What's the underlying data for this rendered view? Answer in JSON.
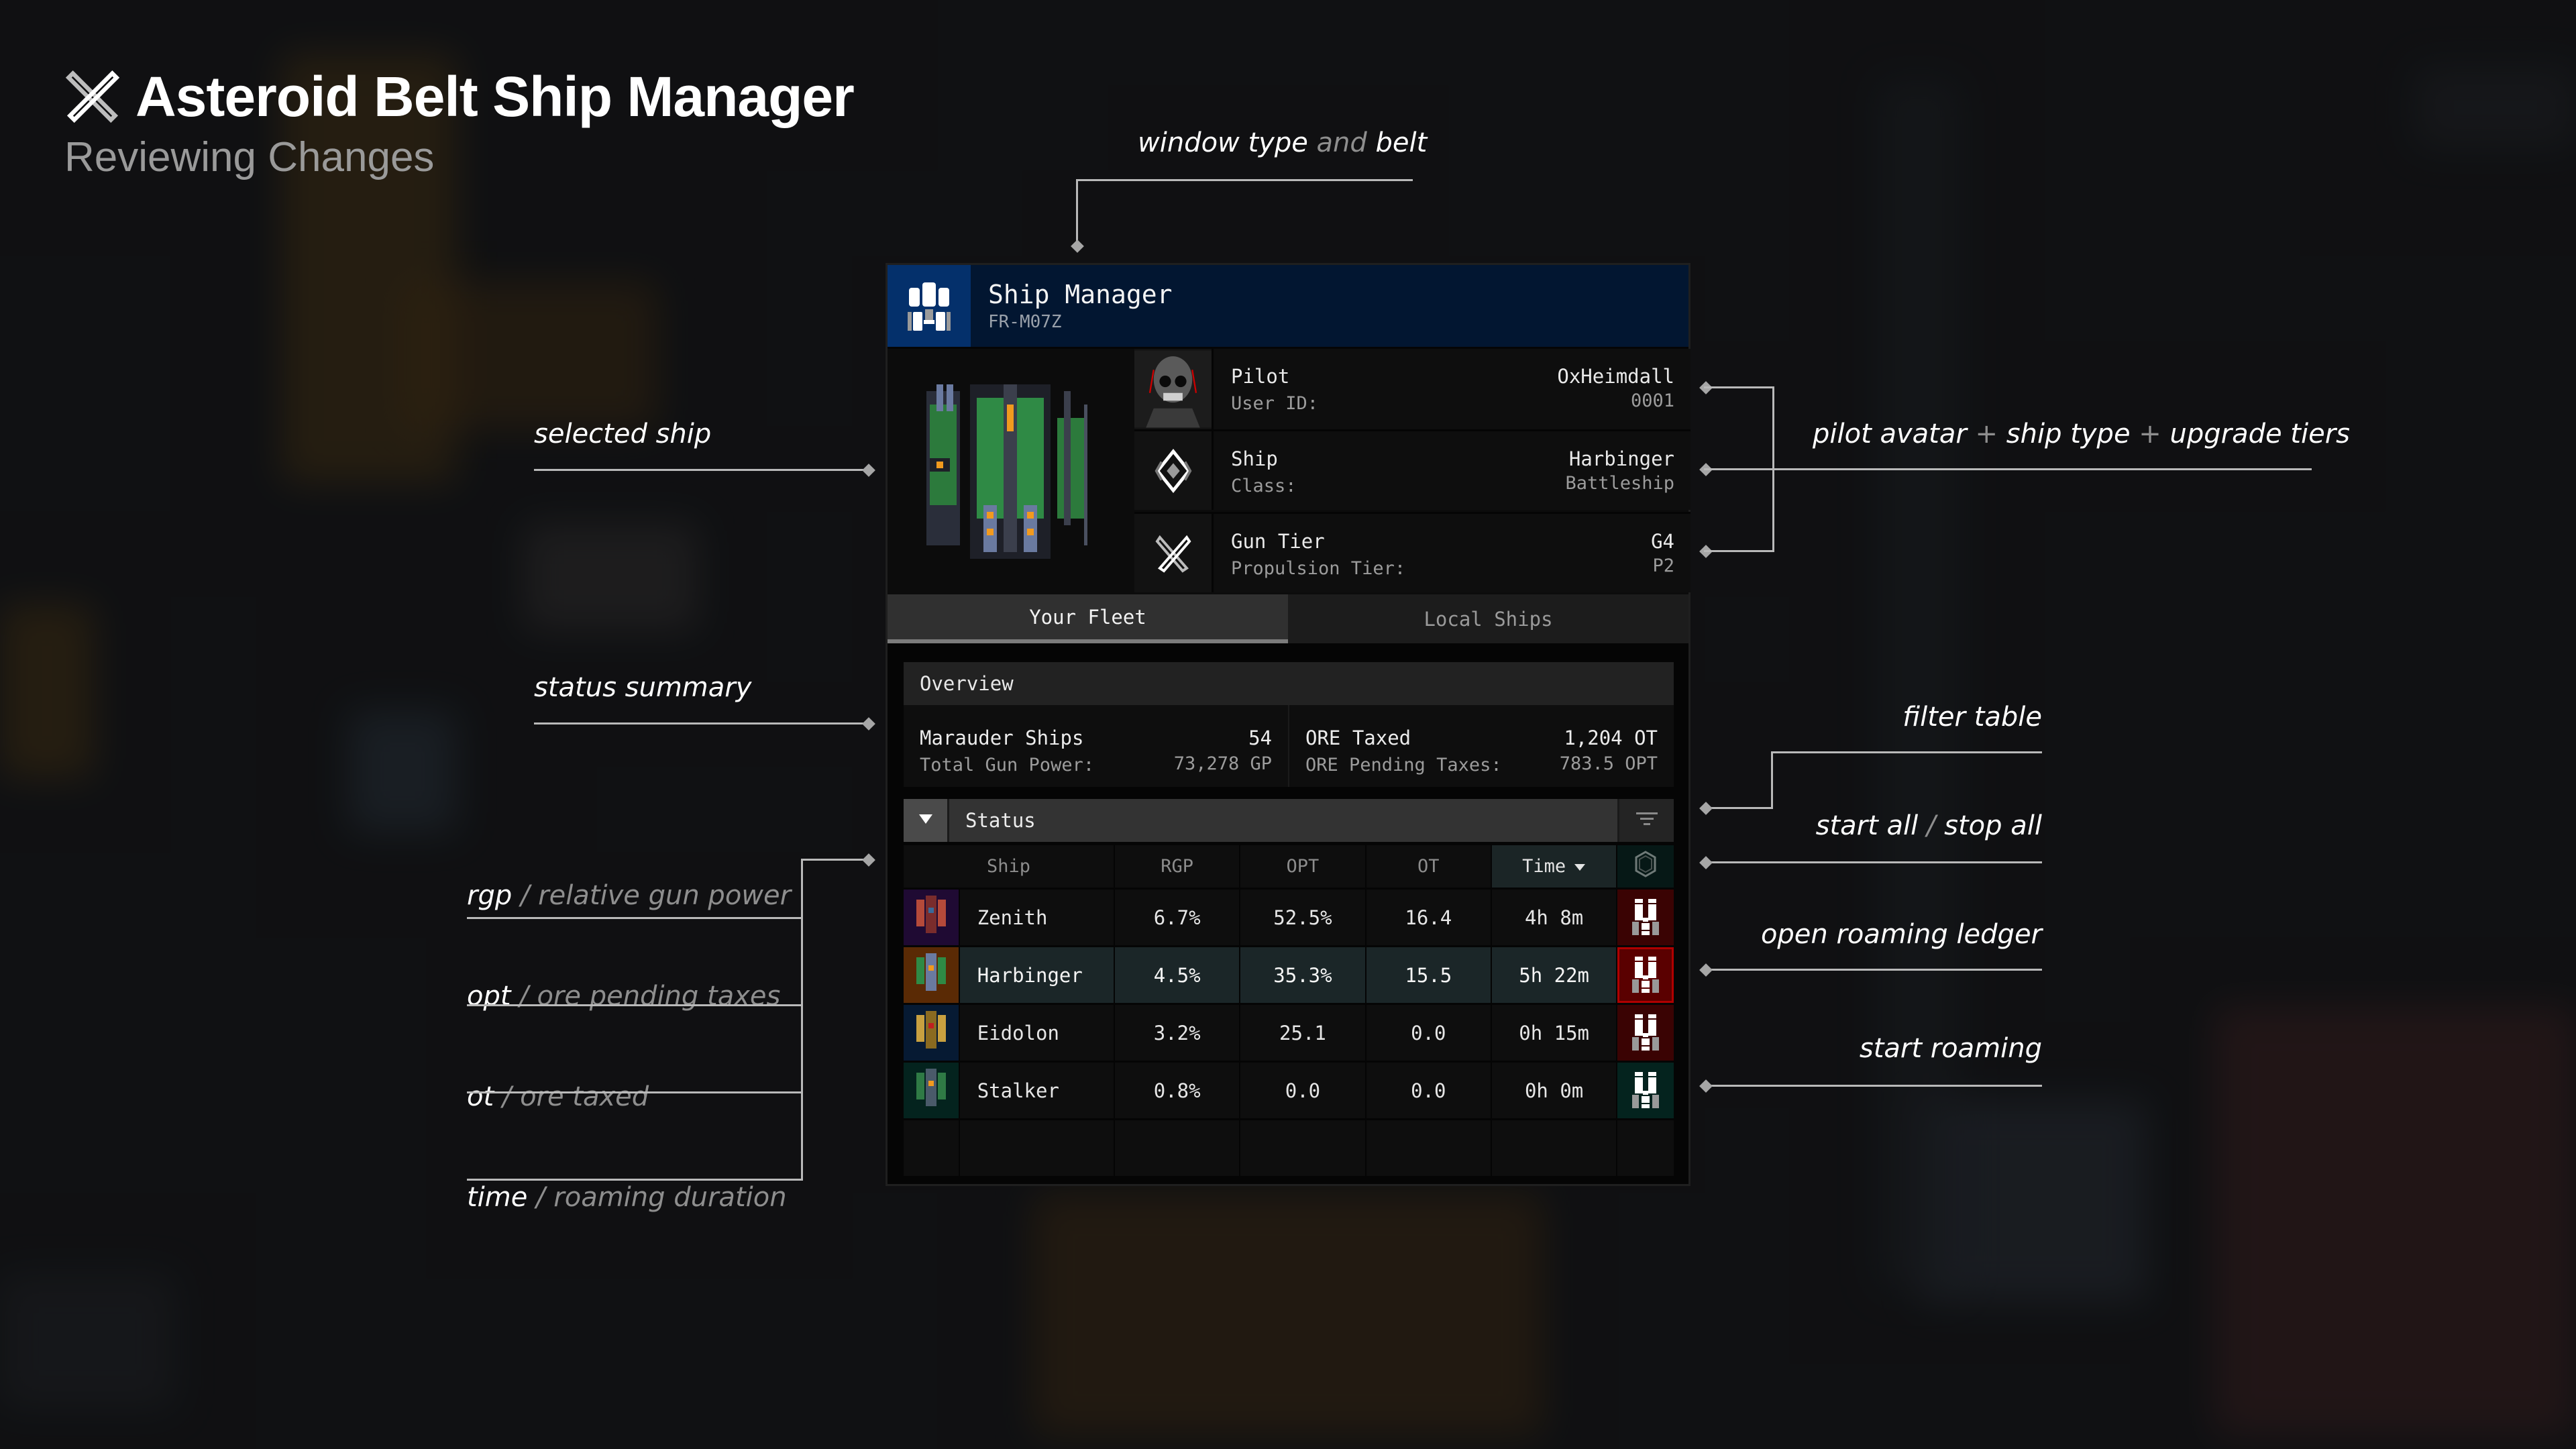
{
  "heading": {
    "title": "Asteroid Belt Ship Manager",
    "subtitle": "Reviewing Changes",
    "icon": "tools-icon"
  },
  "annotations": {
    "window_type": {
      "a": "window type",
      "b": " and ",
      "c": "belt"
    },
    "selected_ship": "selected ship",
    "status_summary": "status summary",
    "pilot_info": {
      "a": "pilot avatar",
      "sep1": " + ",
      "b": "ship type",
      "sep2": " + ",
      "c": "upgrade tiers"
    },
    "filter_table": "filter table",
    "start_stop": {
      "a": "start all",
      "sep": " / ",
      "b": "stop all"
    },
    "open_ledger": "open roaming ledger",
    "start_roaming": "start roaming",
    "rgp": {
      "key": "rgp",
      "sep": " / ",
      "desc": "relative gun power"
    },
    "opt": {
      "key": "opt",
      "sep": " / ",
      "desc": "ore pending taxes"
    },
    "ot": {
      "key": "ot",
      "sep": " / ",
      "desc": "ore taxed"
    },
    "time": {
      "key": "time",
      "sep": " / ",
      "desc": "roaming duration"
    }
  },
  "panel": {
    "title": "Ship Manager",
    "belt_code": "FR-M07Z",
    "header_icon": "ship-manager-icon",
    "pilot": {
      "label": "Pilot",
      "value": "OxHeimdall",
      "sub_label": "User ID:",
      "sub_value": "0001"
    },
    "ship": {
      "label": "Ship",
      "value": "Harbinger",
      "sub_label": "Class:",
      "sub_value": "Battleship"
    },
    "tiers": {
      "label": "Gun Tier",
      "value": "G4",
      "sub_label": "Propulsion Tier:",
      "sub_value": "P2"
    },
    "tabs": [
      {
        "label": "Your Fleet",
        "active": true
      },
      {
        "label": "Local Ships",
        "active": false
      }
    ],
    "overview": {
      "title": "Overview",
      "left": {
        "label": "Marauder Ships",
        "value": "54",
        "sub_label": "Total Gun Power:",
        "sub_value": "73,278 GP"
      },
      "right": {
        "label": "ORE Taxed",
        "value": "1,204 OT",
        "sub_label": "ORE Pending Taxes:",
        "sub_value": "783.5 OPT"
      }
    },
    "status": {
      "label": "Status"
    },
    "table": {
      "columns": [
        "Ship",
        "RGP",
        "OPT",
        "OT",
        "Time"
      ],
      "sorted_column": "Time",
      "rows": [
        {
          "ship": "Zenith",
          "rgp": "6.7%",
          "opt": "52.5%",
          "ot": "16.4",
          "time": "4h 8m",
          "icon_bg": "#1f0a33",
          "state": "roaming",
          "selected": false
        },
        {
          "ship": "Harbinger",
          "rgp": "4.5%",
          "opt": "35.3%",
          "ot": "15.5",
          "time": "5h 22m",
          "icon_bg": "#5a2a05",
          "state": "roaming",
          "selected": true
        },
        {
          "ship": "Eidolon",
          "rgp": "3.2%",
          "opt": "25.1",
          "ot": "0.0",
          "time": "0h 15m",
          "icon_bg": "#061a33",
          "state": "roaming",
          "selected": false
        },
        {
          "ship": "Stalker",
          "rgp": "0.8%",
          "opt": "0.0",
          "ot": "0.0",
          "time": "0h 0m",
          "icon_bg": "#04231e",
          "state": "idle",
          "selected": false
        }
      ]
    }
  },
  "colors": {
    "header_bg": "#021631",
    "header_icon_bg": "#04306b",
    "roaming_btn": "#3a0303",
    "roaming_btn_selected": "#5a0000",
    "idle_btn": "#04231e",
    "selected_row": "#1b2628"
  }
}
